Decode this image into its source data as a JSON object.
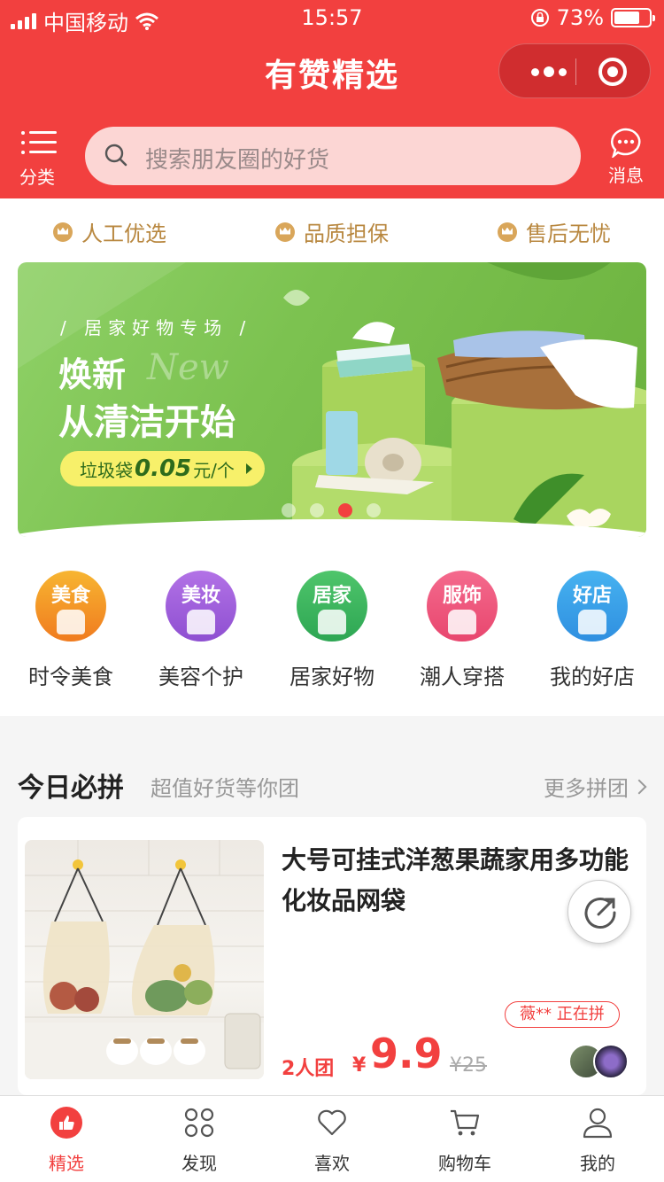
{
  "status_bar": {
    "carrier": "中国移动",
    "time": "15:57",
    "battery": "73%",
    "battery_level": 0.73
  },
  "nav": {
    "title": "有赞精选"
  },
  "header": {
    "category_label": "分类",
    "search_placeholder": "搜索朋友圈的好货",
    "message_label": "消息"
  },
  "guarantees": [
    "人工优选",
    "品质担保",
    "售后无忧"
  ],
  "banner": {
    "subtitle": "/ 居家好物专场 /",
    "headline_1": "焕新",
    "headline_deco": "New",
    "headline_2": "从清洁开始",
    "promo_prefix": "垃圾袋",
    "promo_price": "0.05",
    "promo_suffix": "元/个",
    "slide_count": 4,
    "active_slide": 3
  },
  "categories": [
    {
      "badge": "美食",
      "label": "时令美食",
      "color_top": "#f7b531",
      "color_bottom": "#f07b1f",
      "icon": "apple-icon"
    },
    {
      "badge": "美妆",
      "label": "美容个护",
      "color_top": "#b272e6",
      "color_bottom": "#8e4fd1",
      "icon": "face-icon"
    },
    {
      "badge": "居家",
      "label": "居家好物",
      "color_top": "#4fc56b",
      "color_bottom": "#2da653",
      "icon": "pot-icon"
    },
    {
      "badge": "服饰",
      "label": "潮人穿搭",
      "color_top": "#f46a8d",
      "color_bottom": "#e8466e",
      "icon": "shirt-icon"
    },
    {
      "badge": "好店",
      "label": "我的好店",
      "color_top": "#46b2f0",
      "color_bottom": "#2f8fe0",
      "icon": "shop-icon"
    }
  ],
  "deals": {
    "title": "今日必拼",
    "subtitle": "超值好货等你团",
    "more": "更多拼团",
    "product": {
      "name": "大号可挂式洋葱果蔬家用多功能化妆品网袋",
      "joining": "薇** 正在拼",
      "group": "2人团",
      "currency": "¥",
      "price": "9.9",
      "original_price": "¥25"
    }
  },
  "tabs": [
    {
      "label": "精选",
      "icon": "thumbs-up-icon",
      "active": true
    },
    {
      "label": "发现",
      "icon": "grid-icon",
      "active": false
    },
    {
      "label": "喜欢",
      "icon": "heart-icon",
      "active": false
    },
    {
      "label": "购物车",
      "icon": "cart-icon",
      "active": false
    },
    {
      "label": "我的",
      "icon": "user-icon",
      "active": false
    }
  ],
  "colors": {
    "brand": "#f2403f",
    "gold": "#b8873f"
  }
}
